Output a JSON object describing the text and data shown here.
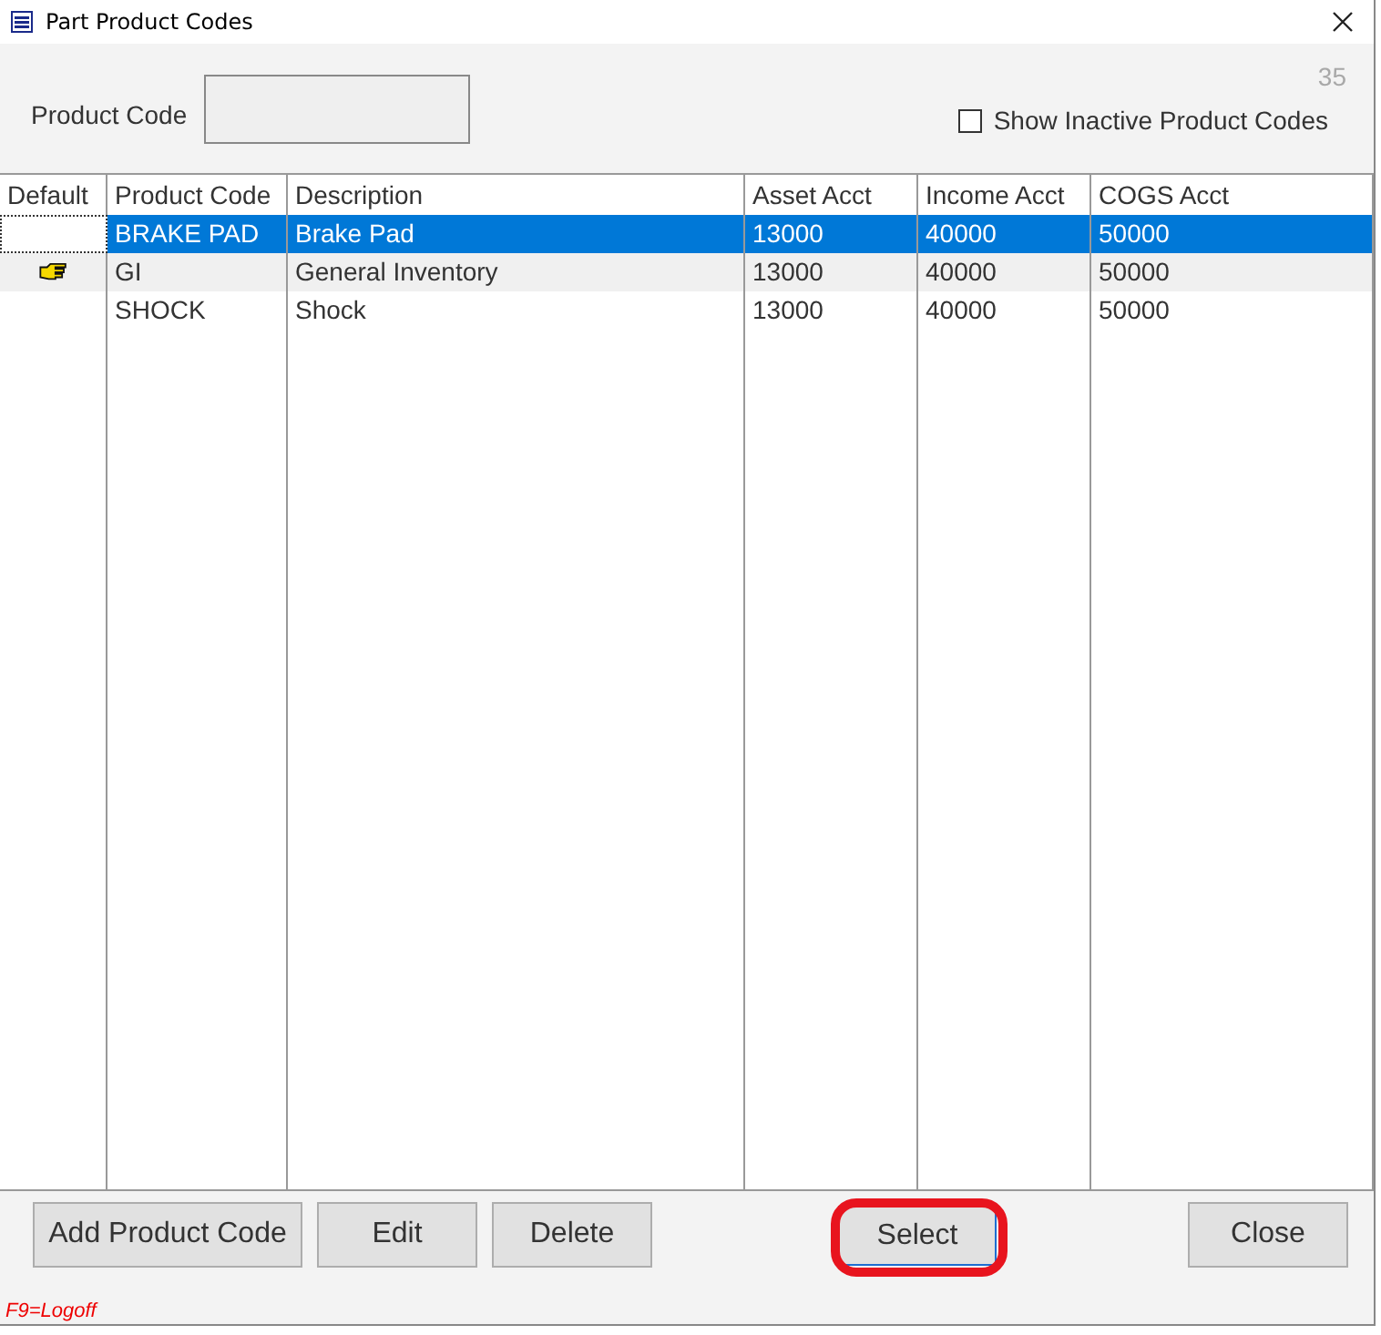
{
  "window": {
    "title": "Part Product Codes"
  },
  "count": "35",
  "filter": {
    "label": "Product Code"
  },
  "show_inactive": {
    "label": "Show Inactive Product Codes",
    "checked": false
  },
  "table": {
    "columns": [
      "Default",
      "Product Code",
      "Description",
      "Asset  Acct",
      "Income Acct",
      "COGS Acct"
    ],
    "rows": [
      {
        "default": false,
        "selected": true,
        "cells": [
          "",
          "BRAKE PAD",
          "Brake Pad",
          "13000",
          "40000",
          "50000"
        ]
      },
      {
        "default": true,
        "selected": false,
        "cells": [
          "",
          "GI",
          "General Inventory",
          "13000",
          "40000",
          "50000"
        ]
      },
      {
        "default": false,
        "selected": false,
        "cells": [
          "",
          "SHOCK",
          "Shock",
          "13000",
          "40000",
          "50000"
        ]
      }
    ]
  },
  "buttons": [
    {
      "label": "Add Product Code",
      "highlighted": false
    },
    {
      "label": "Edit",
      "highlighted": false
    },
    {
      "label": "Delete",
      "highlighted": false
    },
    {
      "label": "Select",
      "highlighted": true
    },
    {
      "label": "Close",
      "highlighted": false
    }
  ],
  "hint": "F9=Logoff"
}
